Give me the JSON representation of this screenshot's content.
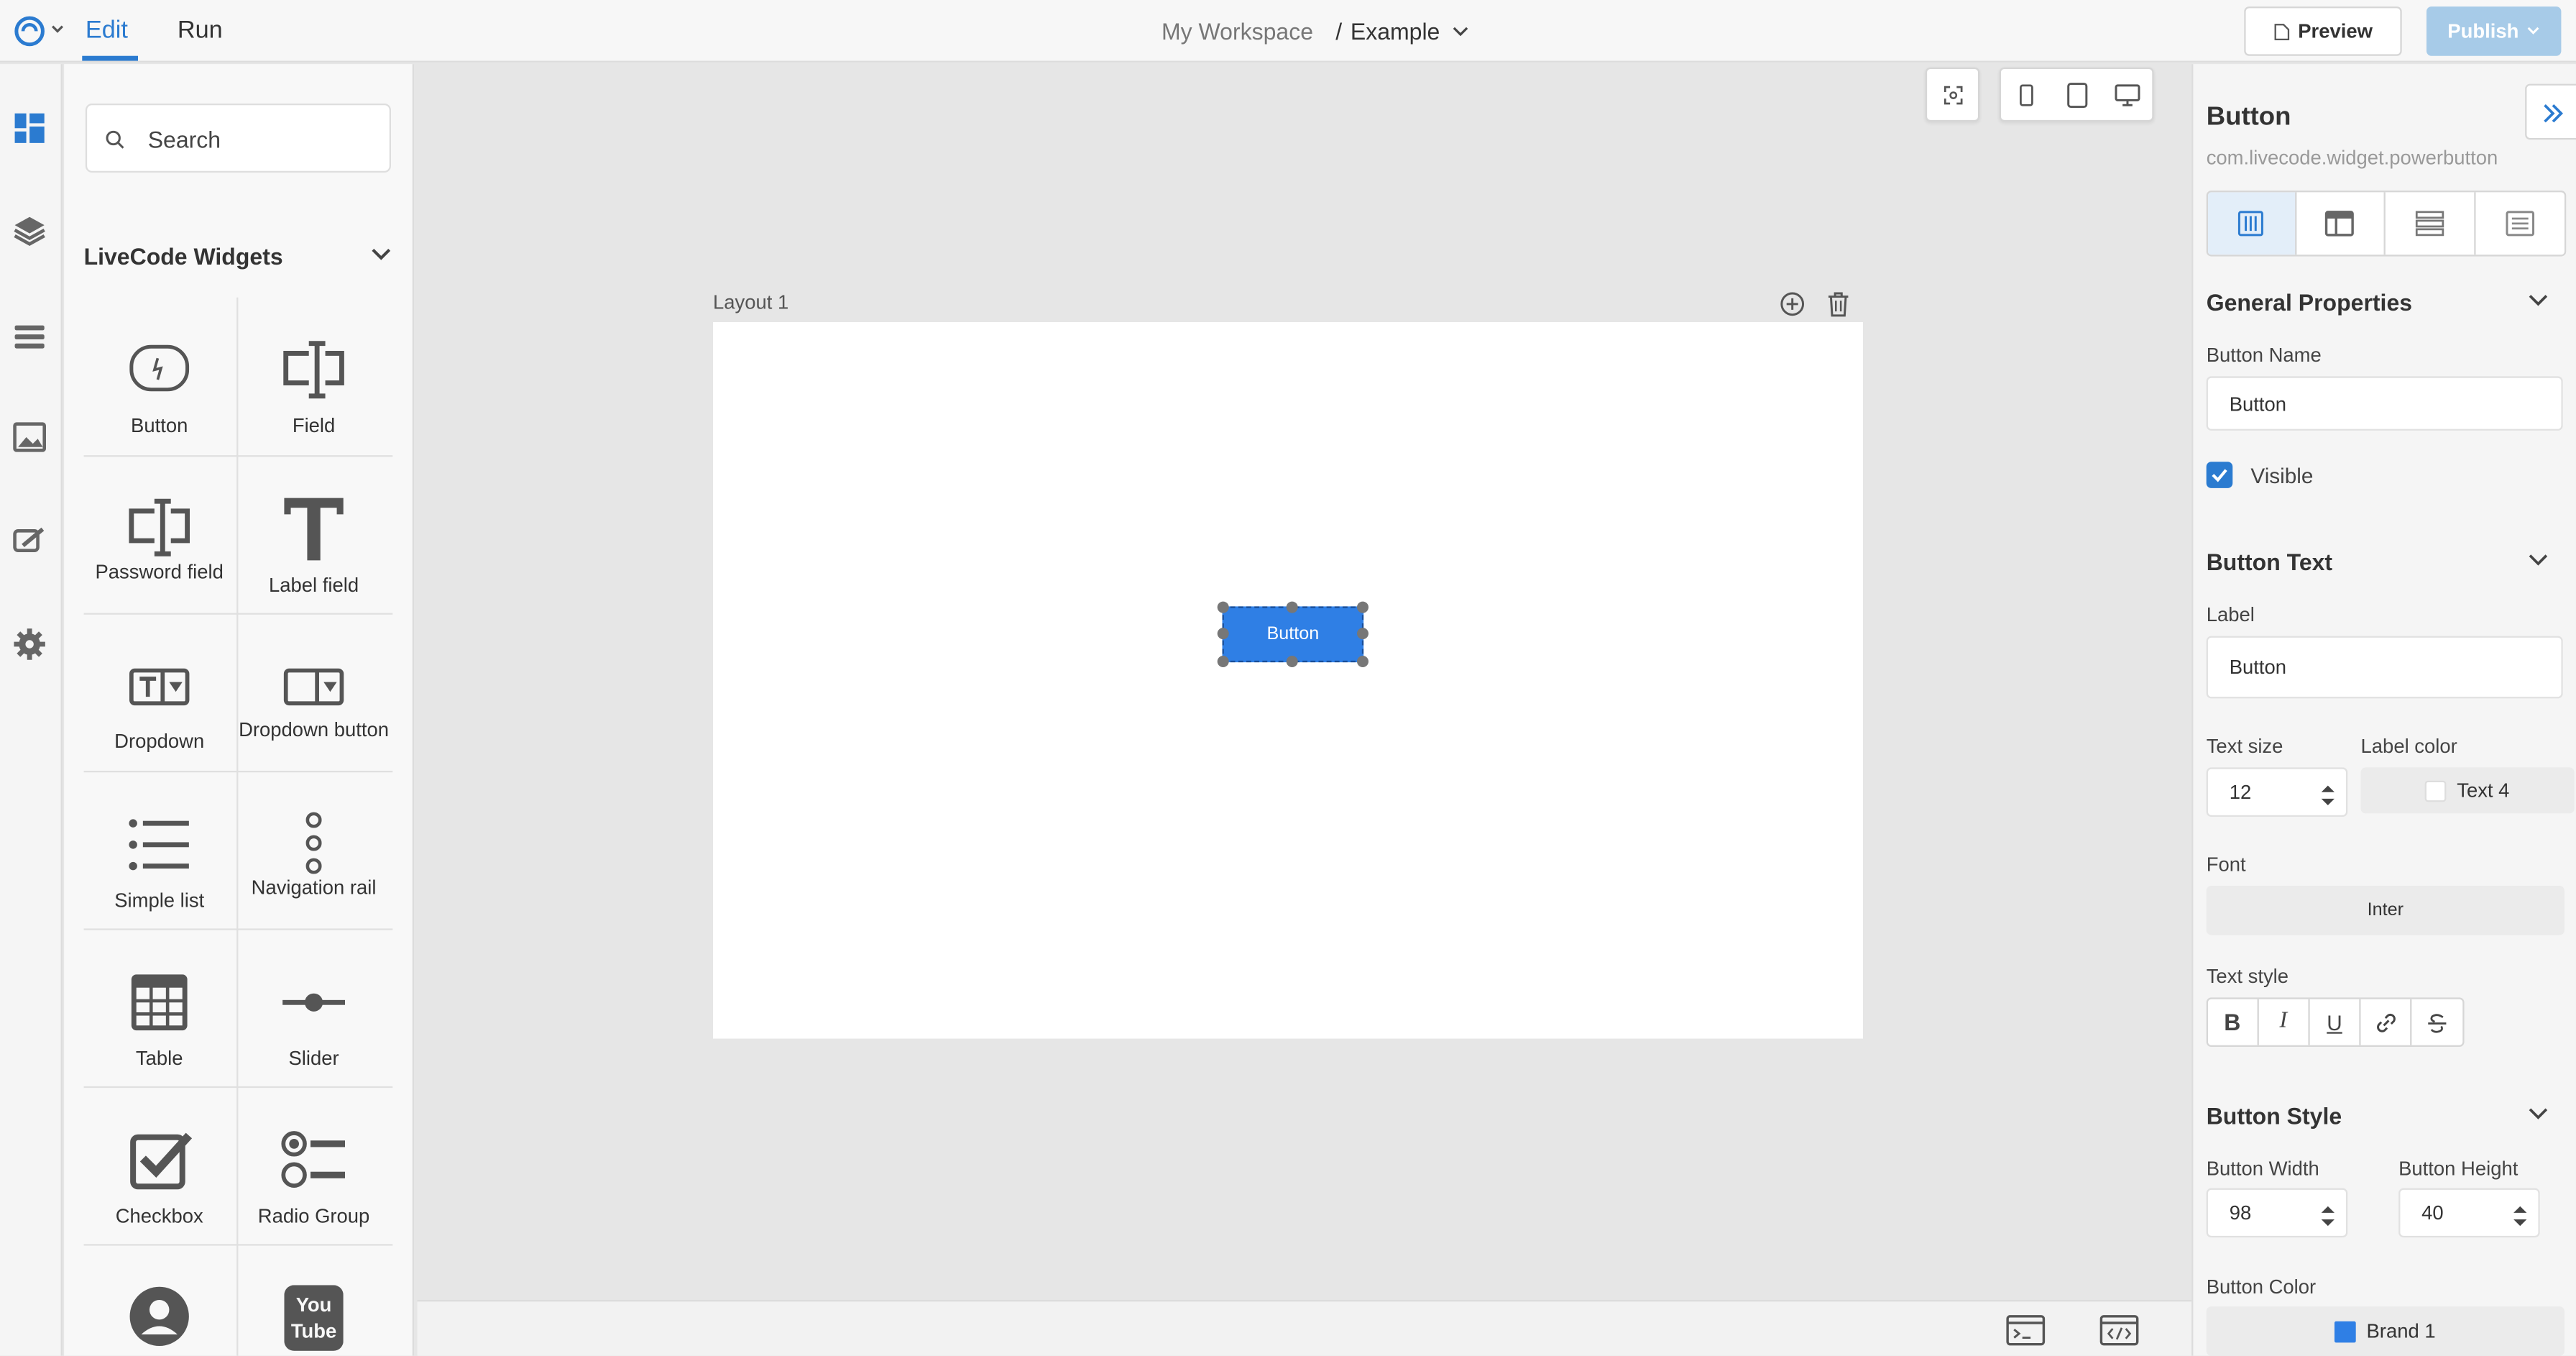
{
  "topbar": {
    "tabs": [
      {
        "label": "Edit"
      },
      {
        "label": "Run"
      }
    ],
    "breadcrumb": {
      "workspace": "My Workspace",
      "separator": "/",
      "project": "Example"
    },
    "preview_label": "Preview",
    "publish_label": "Publish"
  },
  "rail": {
    "icons": [
      "widgets-icon",
      "layers-icon",
      "list-icon",
      "image-icon",
      "palette-icon",
      "gear-icon"
    ]
  },
  "widget_panel": {
    "search": {
      "placeholder": "Search"
    },
    "section_title": "LiveCode Widgets",
    "widgets": [
      {
        "label": "Button",
        "icon": "power-button-icon"
      },
      {
        "label": "Field",
        "icon": "field-icon"
      },
      {
        "label": "Password field",
        "icon": "password-field-icon"
      },
      {
        "label": "Label field",
        "icon": "label-field-icon"
      },
      {
        "label": "Dropdown",
        "icon": "dropdown-icon"
      },
      {
        "label": "Dropdown button",
        "icon": "dropdown-button-icon"
      },
      {
        "label": "Simple list",
        "icon": "simple-list-icon"
      },
      {
        "label": "Navigation rail",
        "icon": "navigation-rail-icon"
      },
      {
        "label": "Table",
        "icon": "table-icon"
      },
      {
        "label": "Slider",
        "icon": "slider-icon"
      },
      {
        "label": "Checkbox",
        "icon": "checkbox-icon"
      },
      {
        "label": "Radio Group",
        "icon": "radio-group-icon"
      },
      {
        "label": "",
        "icon": "avatar-icon"
      },
      {
        "label": "",
        "icon": "youtube-icon"
      }
    ]
  },
  "canvas": {
    "layout_label": "Layout 1",
    "selected_button_label": "Button"
  },
  "properties": {
    "title": "Button",
    "subtitle": "com.livecode.widget.powerbutton",
    "general": {
      "heading": "General Properties",
      "name_label": "Button Name",
      "name_value": "Button",
      "visible_label": "Visible",
      "visible_checked": true
    },
    "button_text": {
      "heading": "Button Text",
      "label_label": "Label",
      "label_value": "Button",
      "text_size_label": "Text size",
      "text_size_value": "12",
      "label_color_label": "Label color",
      "label_color_value": "Text 4",
      "font_label": "Font",
      "font_value": "Inter",
      "text_style_label": "Text style",
      "text_style_buttons": [
        "B",
        "I",
        "U",
        "link",
        "strike"
      ]
    },
    "button_style": {
      "heading": "Button Style",
      "width_label": "Button Width",
      "width_value": "98",
      "height_label": "Button Height",
      "height_value": "40",
      "color_label": "Button Color",
      "color_value": "Brand 1",
      "color_swatch": "#2f7fe5"
    }
  },
  "colors": {
    "accent": "#2b7bd0",
    "publish": "#a7cbe8",
    "selected_button": "#2f7fe5"
  }
}
